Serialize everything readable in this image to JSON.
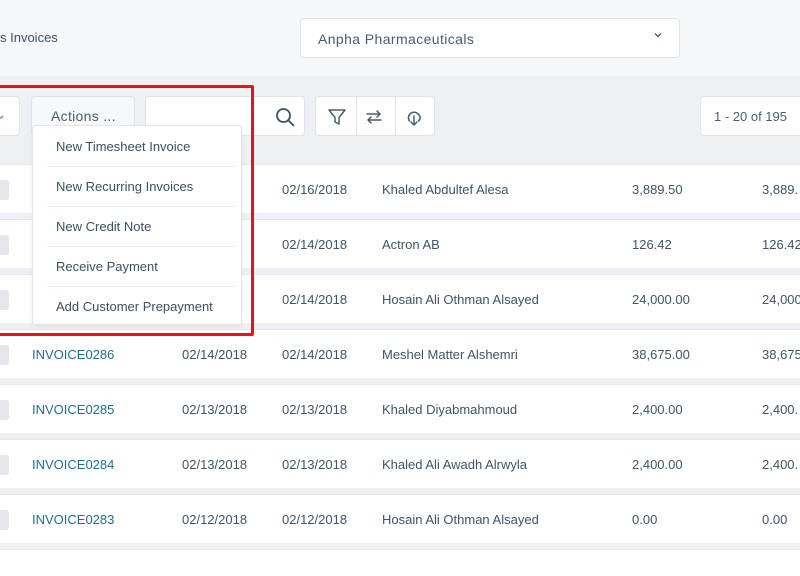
{
  "header": {
    "title": "s Invoices",
    "company_selector": {
      "value": "Anpha Pharmaceuticals",
      "icon": "chevron-down-icon"
    }
  },
  "toolbar": {
    "actions_label": "Actions ...",
    "search_value": "",
    "icons": [
      "search-icon",
      "filter-icon",
      "sync-icon",
      "download-icon"
    ],
    "pagination": "1 - 20 of 195"
  },
  "actions_menu": {
    "items": [
      {
        "label": "New Timesheet Invoice"
      },
      {
        "label": "New Recurring Invoices"
      },
      {
        "label": "New Credit Note"
      },
      {
        "label": "Receive Payment"
      },
      {
        "label": "Add Customer Prepayment"
      }
    ]
  },
  "invoices": [
    {
      "invoice": "",
      "date": "",
      "due": "02/16/2018",
      "customer": "Khaled Abdultef Alesa",
      "amount": "3,889.50",
      "balance": "3,889."
    },
    {
      "invoice": "",
      "date": "",
      "due": "02/14/2018",
      "customer": "Actron AB",
      "amount": "126.42",
      "balance": "126.42"
    },
    {
      "invoice": "",
      "date": "",
      "due": "02/14/2018",
      "customer": "Hosain Ali Othman Alsayed",
      "amount": "24,000.00",
      "balance": "24,000"
    },
    {
      "invoice": "INVOICE0286",
      "date": "02/14/2018",
      "due": "02/14/2018",
      "customer": "Meshel Matter Alshemri",
      "amount": "38,675.00",
      "balance": "38,675"
    },
    {
      "invoice": "INVOICE0285",
      "date": "02/13/2018",
      "due": "02/13/2018",
      "customer": "Khaled Diyabmahmoud",
      "amount": "2,400.00",
      "balance": "2,400."
    },
    {
      "invoice": "INVOICE0284",
      "date": "02/13/2018",
      "due": "02/13/2018",
      "customer": "Khaled Ali Awadh Alrwyla",
      "amount": "2,400.00",
      "balance": "2,400."
    },
    {
      "invoice": "INVOICE0283",
      "date": "02/12/2018",
      "due": "02/12/2018",
      "customer": "Hosain Ali Othman Alsayed",
      "amount": "0.00",
      "balance": "0.00"
    }
  ],
  "colors": {
    "accent_link": "#1f6f8b",
    "highlight": "#e3151b"
  }
}
